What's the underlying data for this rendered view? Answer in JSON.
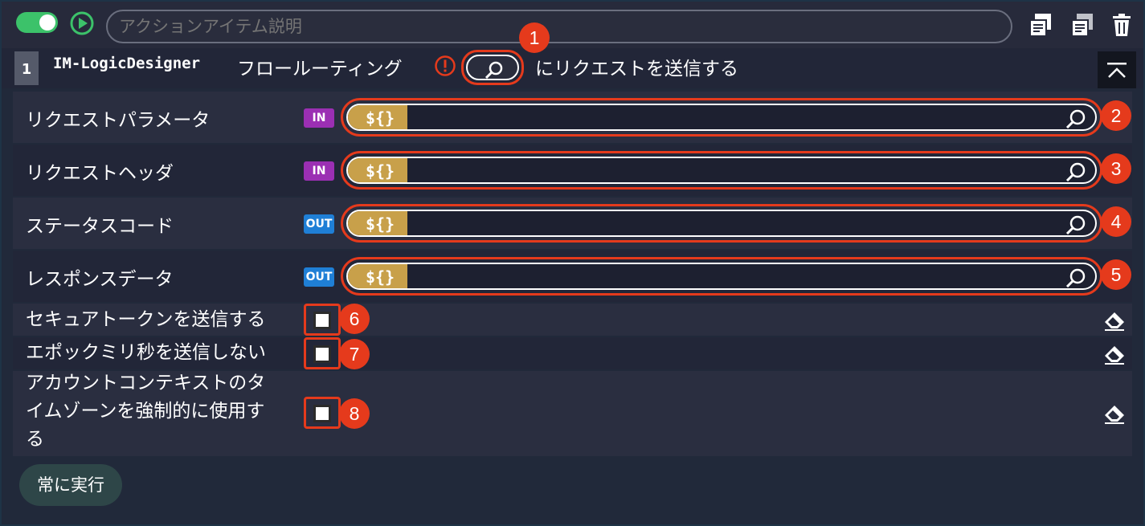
{
  "header": {
    "description_placeholder": "アクションアイテム説明",
    "toggle_state": "on",
    "icons": [
      "play-icon",
      "copy-icon",
      "paste-icon",
      "trash-icon"
    ]
  },
  "action": {
    "step_number": "1",
    "title_code": "IM-LogicDesigner",
    "title_jp": "フロールーティング",
    "title_tail": "にリクエストを送信する"
  },
  "params": [
    {
      "label": "リクエストパラメータ",
      "tag": "IN",
      "var": "${}"
    },
    {
      "label": "リクエストヘッダ",
      "tag": "IN",
      "var": "${}"
    },
    {
      "label": "ステータスコード",
      "tag": "OUT",
      "var": "${}"
    },
    {
      "label": "レスポンスデータ",
      "tag": "OUT",
      "var": "${}"
    }
  ],
  "checks": [
    {
      "label": "セキュアトークンを送信する",
      "checked": false
    },
    {
      "label": "エポックミリ秒を送信しない",
      "checked": false
    },
    {
      "label_lines": [
        "アカウントコンテキストのタ",
        "イムゾーンを強制的に使用す",
        "る"
      ],
      "checked": false
    }
  ],
  "badges": [
    "1",
    "2",
    "3",
    "4",
    "5",
    "6",
    "7",
    "8"
  ],
  "footer": {
    "always_run_label": "常に実行"
  },
  "colors": {
    "accent_highlight": "#e53a1c",
    "in_tag": "#9b2fb3",
    "out_tag": "#1f7fd6",
    "variable_chip": "#c8a04a",
    "toggle_on": "#3cc26a"
  }
}
